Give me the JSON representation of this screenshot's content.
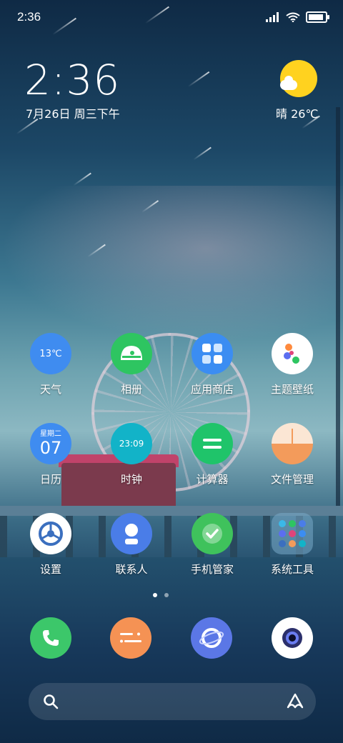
{
  "status_bar": {
    "time": "2:36",
    "battery_level": 0.9
  },
  "clock_widget": {
    "time": "2:36",
    "date": "7月26日 周三下午"
  },
  "weather_widget": {
    "text": "晴 26℃"
  },
  "apps": [
    {
      "label": "天气",
      "icon": "weather-icon",
      "color": "#3f8cf0",
      "inner_text": "13℃"
    },
    {
      "label": "相册",
      "icon": "gallery-icon",
      "color": "#2ec561"
    },
    {
      "label": "应用商店",
      "icon": "app-store-icon",
      "color": "#3b8df2"
    },
    {
      "label": "主题壁纸",
      "icon": "themes-icon",
      "color": "#ffffff"
    },
    {
      "label": "日历",
      "icon": "calendar-icon",
      "color": "#3f8cf0",
      "inner_top": "星期二",
      "inner_text": "07"
    },
    {
      "label": "时钟",
      "icon": "clock-icon",
      "color": "#12b3c8",
      "inner_text": "23:09"
    },
    {
      "label": "计算器",
      "icon": "calculator-icon",
      "color": "#1fc46a"
    },
    {
      "label": "文件管理",
      "icon": "file-manager-icon",
      "color": "#f39b5b"
    },
    {
      "label": "设置",
      "icon": "settings-icon",
      "color": "#ffffff"
    },
    {
      "label": "联系人",
      "icon": "contacts-icon",
      "color": "#4a7de8"
    },
    {
      "label": "手机管家",
      "icon": "security-icon",
      "color": "#3fc25c"
    },
    {
      "label": "系统工具",
      "icon": "system-tools-folder-icon",
      "color": "#6aa0c0"
    }
  ],
  "dock": [
    {
      "icon": "phone-icon",
      "color": "#3cc76a"
    },
    {
      "icon": "messages-icon",
      "color": "#f59254"
    },
    {
      "icon": "browser-icon",
      "color": "#5b77e6"
    },
    {
      "icon": "camera-icon",
      "color": "#ffffff"
    }
  ],
  "page_indicator": {
    "pages": 2,
    "current": 1
  },
  "search_bar": {
    "left_icon": "search-icon",
    "right_icon": "assistant-icon"
  }
}
